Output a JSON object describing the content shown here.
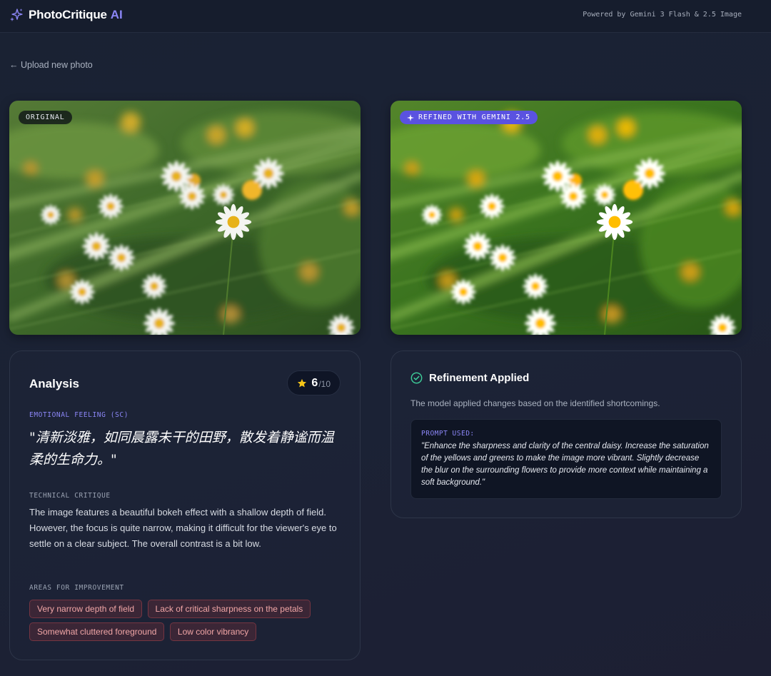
{
  "header": {
    "brand": "PhotoCritique",
    "brand_accent": "AI",
    "powered_by": "Powered by Gemini 3 Flash & 2.5 Image"
  },
  "nav": {
    "back_label": "← Upload new photo"
  },
  "photos": {
    "original_tag": "ORIGINAL",
    "refined_tag": "REFINED WITH GEMINI 2.5"
  },
  "analysis": {
    "title": "Analysis",
    "score": "6",
    "score_max": "/10",
    "emotional_label": "EMOTIONAL FEELING (SC)",
    "emotional_quote": "\"清新淡雅，如同晨露未干的田野，散发着静谧而温柔的生命力。\"",
    "technical_label": "TECHNICAL CRITIQUE",
    "technical_text": "The image features a beautiful bokeh effect with a shallow depth of field. However, the focus is quite narrow, making it difficult for the viewer's eye to settle on a clear subject. The overall contrast is a bit low.",
    "improvement_label": "AREAS FOR IMPROVEMENT",
    "improvements": [
      "Very narrow depth of field",
      "Lack of critical sharpness on the petals",
      "Somewhat cluttered foreground",
      "Low color vibrancy"
    ]
  },
  "refinement": {
    "title": "Refinement Applied",
    "description": "The model applied changes based on the identified shortcomings.",
    "prompt_label": "PROMPT USED:",
    "prompt_text": "\"Enhance the sharpness and clarity of the central daisy. Increase the saturation of the yellows and greens to make the image more vibrant. Slightly decrease the blur on the surrounding flowers to provide more context while maintaining a soft background.\""
  },
  "colors": {
    "accent": "#8b86f6",
    "refined_badge": "#5a52e0",
    "chip_text": "#f1a6a6",
    "check": "#3ecf9a",
    "star": "#f5c518"
  }
}
